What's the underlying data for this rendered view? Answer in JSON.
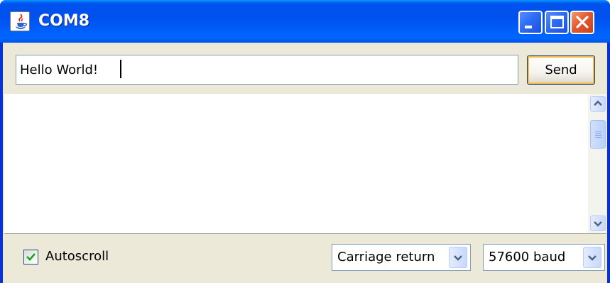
{
  "window": {
    "title": "COM8"
  },
  "send_bar": {
    "input_value": "Hello World!",
    "send_label": "Send"
  },
  "output": {
    "text": ""
  },
  "footer": {
    "autoscroll_label": "Autoscroll",
    "autoscroll_checked": true,
    "line_ending_selected": "Carriage return",
    "baud_rate_selected": "57600 baud"
  },
  "icons": {
    "app": "java-cup-icon",
    "minimize": "minimize-icon",
    "maximize": "maximize-icon",
    "close": "close-icon",
    "scroll_up": "chevron-up-icon",
    "scroll_down": "chevron-down-icon",
    "dropdown": "chevron-down-icon",
    "checkbox": "checkmark-icon"
  },
  "colors": {
    "titlebar": "#0053ee",
    "close_button": "#e25a32",
    "client_background": "#ece9d8",
    "send_button_focus": "#f8b74f"
  }
}
